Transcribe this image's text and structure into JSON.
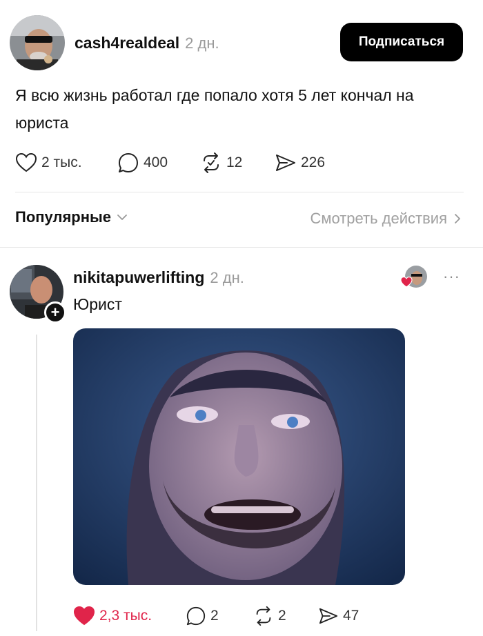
{
  "post": {
    "username": "cash4realdeal",
    "time": "2 дн.",
    "follow_label": "Подписаться",
    "text": "Я всю жизнь работал где попало хотя 5 лет кончал на юриста",
    "stats": {
      "likes": "2 тыс.",
      "comments": "400",
      "reposts": "12",
      "shares": "226"
    }
  },
  "sort_bar": {
    "sort_label": "Популярные",
    "view_activity_label": "Смотреть действия"
  },
  "reply": {
    "username": "nikitapuwerlifting",
    "time": "2 дн.",
    "text": "Юрист",
    "more_label": "···",
    "stats": {
      "likes": "2,3 тыс.",
      "comments": "2",
      "reposts": "2",
      "shares": "47"
    }
  },
  "colors": {
    "liked_heart": "#e0244a",
    "follow_button_bg": "#000000",
    "muted_text": "#9a9a9a"
  },
  "icons": [
    "heart-icon",
    "comment-icon",
    "repost-icon",
    "share-icon",
    "chevron-down-icon",
    "chevron-right-icon",
    "plus-icon",
    "more-icon"
  ]
}
